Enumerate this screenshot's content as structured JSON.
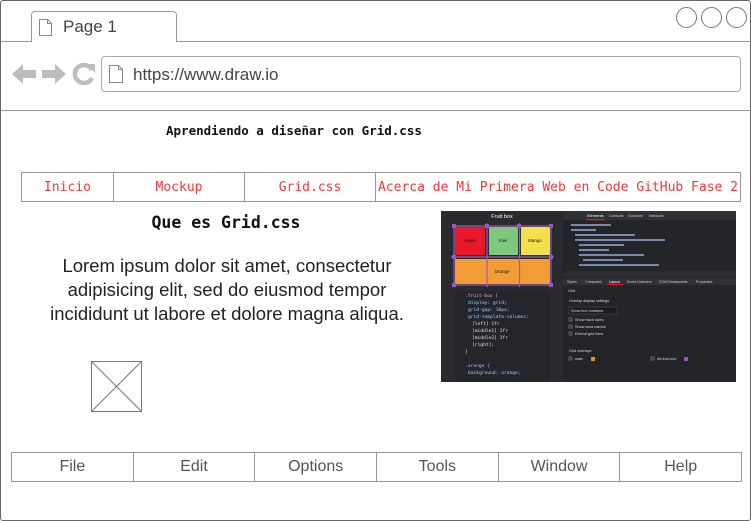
{
  "browser": {
    "tab_label": "Page 1",
    "url": "https://www.draw.io",
    "icons": [
      "back-arrow-icon",
      "forward-arrow-icon",
      "reload-icon",
      "page-icon"
    ]
  },
  "page": {
    "heading": "Aprendiendo a diseñar con Grid.css",
    "nav": [
      "Inicio",
      "Mockup",
      "Grid.css",
      "Acerca de Mi Primera Web en Code GitHub Fase 2"
    ],
    "section_title": "Que es Grid.css",
    "paragraph": "Lorem ipsum dolor sit amet, consectetur adipisicing elit, sed do eiusmod tempor incididunt ut labore et dolore magna aliqua.",
    "screenshot": {
      "title": "Fruit box",
      "cells": [
        "Apple",
        "Kiwi",
        "Mango",
        "Orange"
      ],
      "devtools_tabs": [
        "Elements",
        "Console",
        "Sources",
        "Network"
      ],
      "code": [
        ".fruit-box {",
        "display: grid;",
        "grid-gap: 10px;",
        "grid-template-columns:",
        "[left] 1fr",
        "[middle1] 1fr",
        "[middle2] 1fr",
        "[right];",
        "}",
        ".orange {",
        "background: orange;"
      ],
      "panel_tabs": [
        "Styles",
        "Computed",
        "Layout",
        "Event Listeners",
        "DOM Breakpoints",
        "Properties"
      ],
      "panel": {
        "section": "Grid",
        "overlay_settings": "Overlay display settings",
        "select_value": "Show line numbers",
        "checkboxes": [
          "Show track sizes",
          "Show area names",
          "Extend grid lines"
        ],
        "overlay": "Grid overlays",
        "overlay_items": [
          "main",
          "div.fruit-box"
        ]
      }
    }
  },
  "menu": [
    "File",
    "Edit",
    "Options",
    "Tools",
    "Window",
    "Help"
  ],
  "colors": {
    "nav_text": "#ff3333",
    "apple": "#e8182b",
    "kiwi": "#7ec87e",
    "mango": "#f4e04d",
    "orange": "#f39c35",
    "grid_overlay": "#9b59b6"
  }
}
